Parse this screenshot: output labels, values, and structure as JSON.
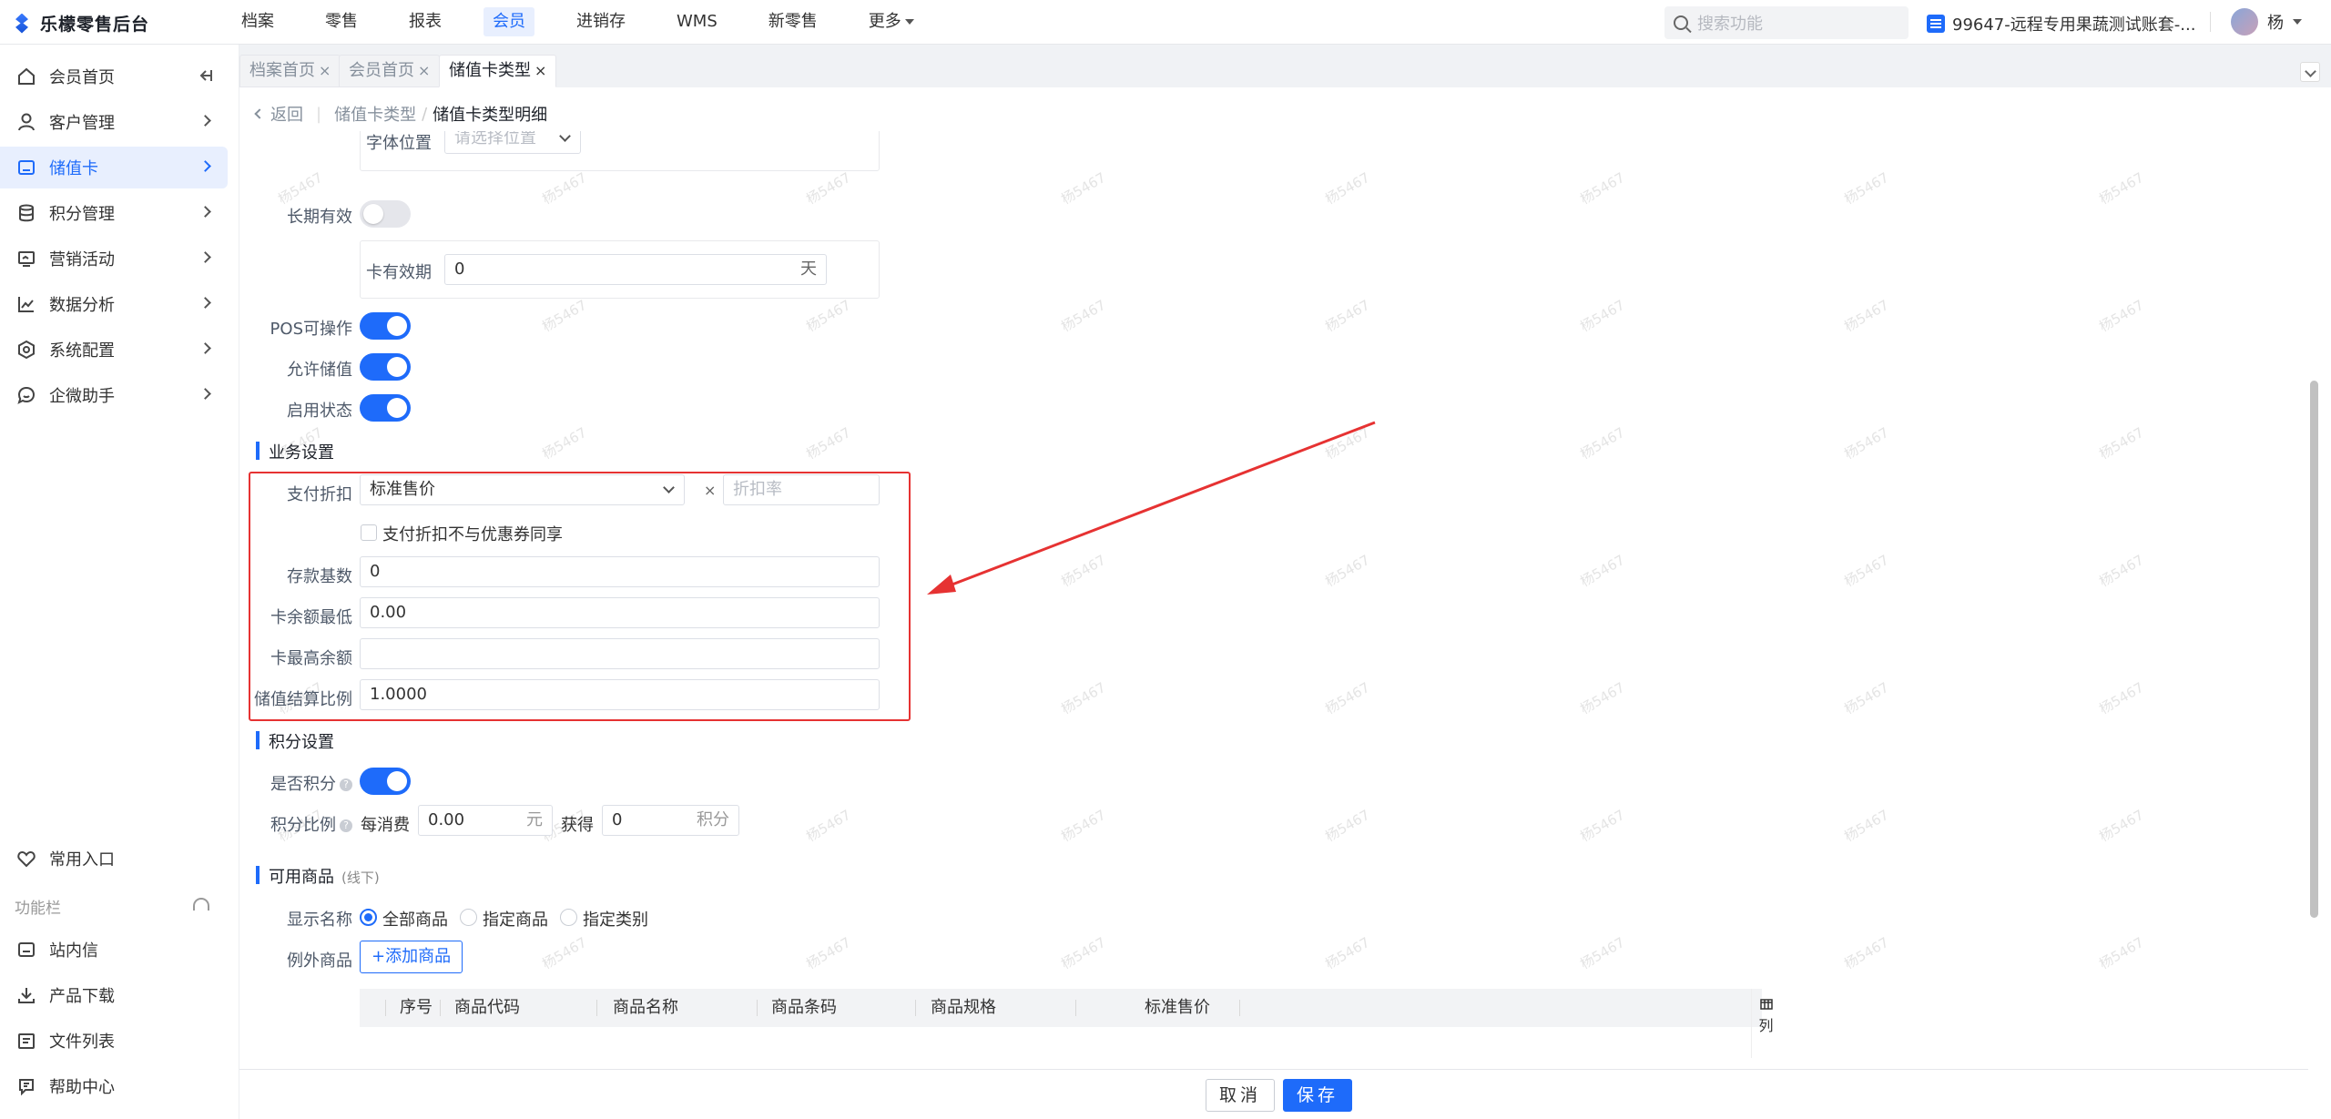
{
  "app": {
    "title": "乐檬零售后台"
  },
  "topnav": {
    "items": [
      "档案",
      "零售",
      "报表",
      "会员",
      "进销存",
      "WMS",
      "新零售",
      "更多"
    ],
    "active": "会员"
  },
  "search": {
    "placeholder": "搜索功能"
  },
  "account": {
    "name": "99647-远程专用果蔬测试账套-..."
  },
  "user": {
    "name": "杨"
  },
  "sidebar": {
    "items": [
      {
        "label": "会员首页",
        "icon": "home-icon"
      },
      {
        "label": "客户管理",
        "icon": "user-icon"
      },
      {
        "label": "储值卡",
        "icon": "card-icon"
      },
      {
        "label": "积分管理",
        "icon": "database-icon"
      },
      {
        "label": "营销活动",
        "icon": "monitor-icon"
      },
      {
        "label": "数据分析",
        "icon": "chart-icon"
      },
      {
        "label": "系统配置",
        "icon": "settings-icon"
      },
      {
        "label": "企微助手",
        "icon": "chat-icon"
      }
    ],
    "active": "储值卡",
    "bottom": {
      "favorites": "常用入口",
      "function_bar": "功能栏",
      "items": [
        {
          "label": "站内信",
          "icon": "mail-icon"
        },
        {
          "label": "产品下载",
          "icon": "download-icon"
        },
        {
          "label": "文件列表",
          "icon": "file-icon"
        },
        {
          "label": "帮助中心",
          "icon": "help-icon"
        }
      ]
    }
  },
  "tabs": [
    {
      "label": "档案首页"
    },
    {
      "label": "会员首页"
    },
    {
      "label": "储值卡类型"
    }
  ],
  "tab_close": "×",
  "breadcrumb": {
    "back": "返回",
    "parent": "储值卡类型",
    "separator": "/",
    "current": "储值卡类型明细"
  },
  "form": {
    "font_position": {
      "label": "字体位置",
      "placeholder": "请选择位置"
    },
    "long_valid": {
      "label": "长期有效",
      "on": false
    },
    "card_validity": {
      "label": "卡有效期",
      "value": "0",
      "unit": "天"
    },
    "pos_operable": {
      "label": "POS可操作",
      "on": true
    },
    "allow_recharge": {
      "label": "允许储值",
      "on": true
    },
    "enabled": {
      "label": "启用状态",
      "on": true
    }
  },
  "business": {
    "title": "业务设置",
    "payment_discount": {
      "label": "支付折扣",
      "value": "标准售价",
      "times": "×",
      "rate_placeholder": "折扣率"
    },
    "no_coupon_share": {
      "label": "支付折扣不与优惠券同享",
      "checked": false
    },
    "deposit_base": {
      "label": "存款基数",
      "value": "0"
    },
    "min_balance": {
      "label": "卡余额最低",
      "value": "0.00"
    },
    "max_balance": {
      "label": "卡最高余额",
      "value": ""
    },
    "settle_ratio": {
      "label": "储值结算比例",
      "value": "1.0000"
    }
  },
  "points": {
    "title": "积分设置",
    "enabled": {
      "label": "是否积分",
      "on": true
    },
    "ratio": {
      "label": "积分比例",
      "per_spend": "每消费",
      "spend_value": "0.00",
      "spend_unit": "元",
      "get": "获得",
      "points_value": "0",
      "points_unit": "积分"
    },
    "help_glyph": "?"
  },
  "products": {
    "title": "可用商品",
    "subtitle": "(线下)",
    "display_label": "显示名称",
    "options": [
      "全部商品",
      "指定商品",
      "指定类别"
    ],
    "selected": "全部商品",
    "exception_label": "例外商品",
    "add_button": "+添加商品",
    "columns": [
      "序号",
      "商品代码",
      "商品名称",
      "商品条码",
      "商品规格",
      "标准售价"
    ],
    "column_button": "列"
  },
  "footer": {
    "cancel": "取消",
    "save": "保存"
  },
  "watermark": "杨5467",
  "colors": {
    "accent": "#1e6bfa",
    "annotation": "#e63232"
  }
}
